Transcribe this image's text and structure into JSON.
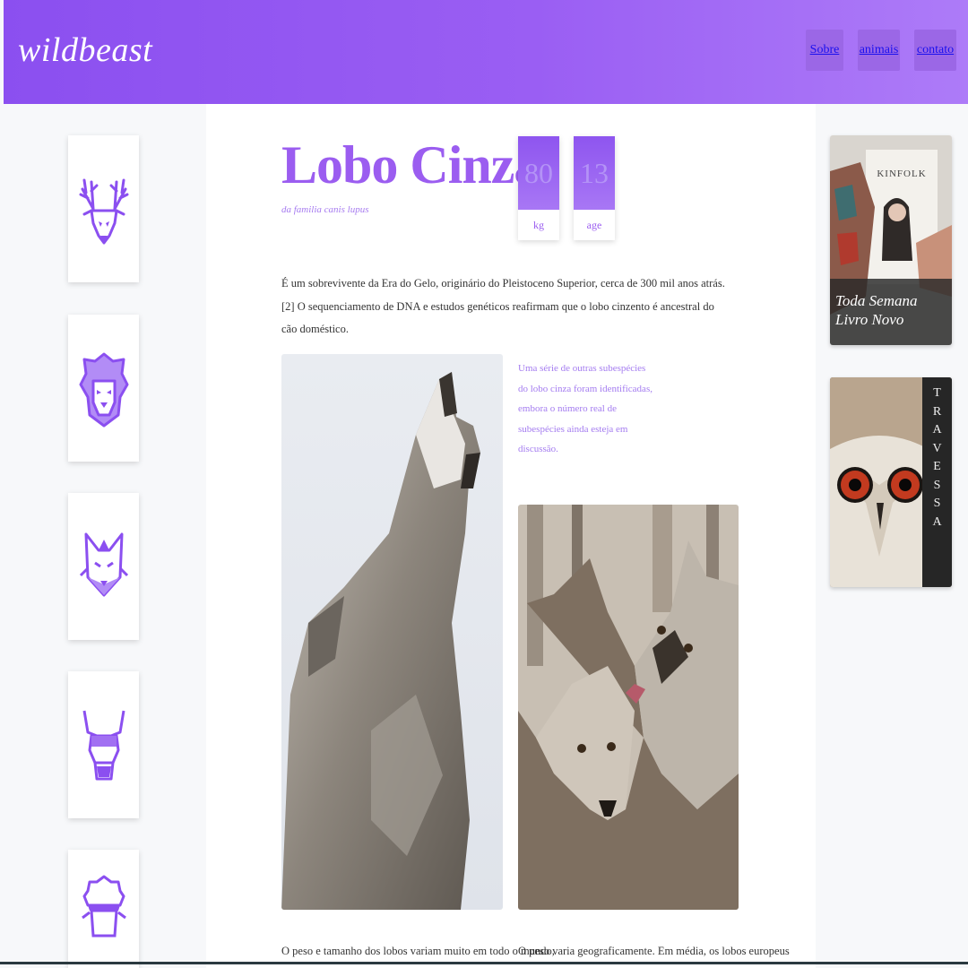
{
  "header": {
    "logo": "wildbeast",
    "nav": [
      "Sobre",
      "animais",
      "contato"
    ]
  },
  "sidebar": {
    "animals": [
      "deer-icon",
      "lion-icon",
      "fox-icon",
      "bull-icon",
      "sheep-icon"
    ]
  },
  "article": {
    "title": "Lobo Cinza",
    "subtitle": "da familia canis lupus",
    "stats": [
      {
        "value": "80",
        "label": "kg"
      },
      {
        "value": "13",
        "label": "age"
      }
    ],
    "intro": "É um sobrevivente da Era do Gelo, originário do Pleistoceno Superior, cerca de 300 mil anos atrás.[2] O sequenciamento de DNA e estudos genéticos reafirmam que o lobo cinzento é ancestral do cão doméstico.",
    "side_quote": "Uma série de outras subespécies do lobo cinza foram identificadas, embora o número real de subespécies ainda esteja em discussão.",
    "bottom_left": "O peso e tamanho dos lobos variam muito em todo o mundo,",
    "bottom_right": "O peso varia geograficamente. Em média, os lobos europeus"
  },
  "promos": {
    "book": {
      "line1": "Toda Semana",
      "line2": "Livro Novo",
      "magazine": "KINFOLK"
    },
    "owl": {
      "vertical": [
        "T",
        "R",
        "A",
        "V",
        "E",
        "S",
        "S",
        "A"
      ]
    }
  },
  "colors": {
    "accent": "#9b5df0",
    "header_start": "#8b4ff0",
    "header_end": "#ad7bf8",
    "nav_link": "#1a10ee"
  }
}
